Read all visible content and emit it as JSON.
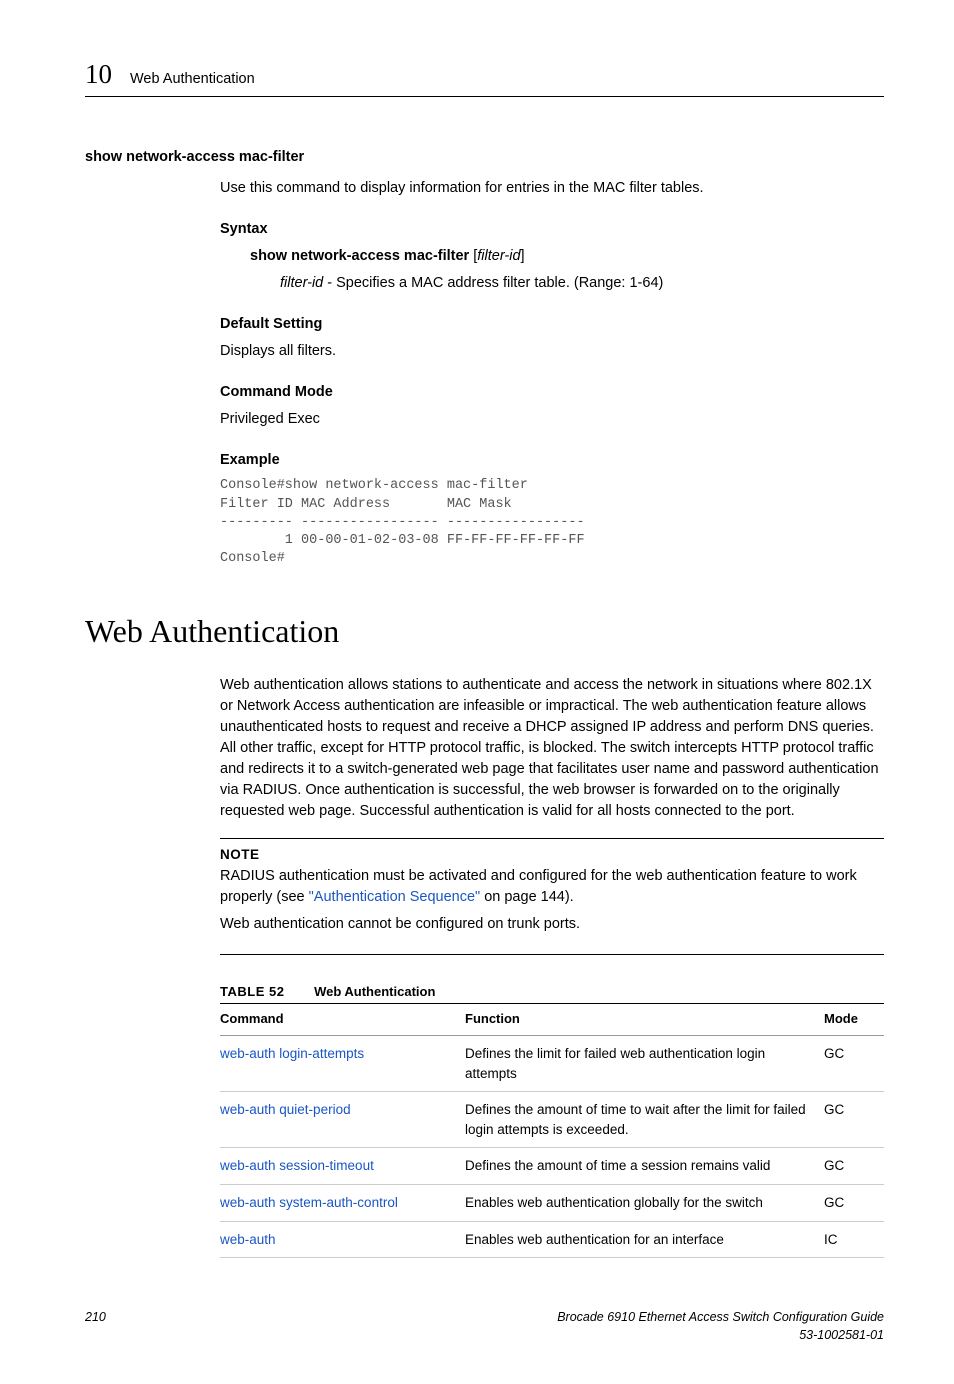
{
  "header": {
    "chapter_num": "10",
    "chapter_title": "Web Authentication"
  },
  "command": {
    "name": "show network-access mac-filter",
    "intro": "Use this command to display information for entries in the MAC filter tables.",
    "syntax_label": "Syntax",
    "syntax_cmd_bold": "show network-access mac-filter",
    "syntax_cmd_arg": "filter-id",
    "syntax_desc_prefix": "filter-id",
    "syntax_desc_rest": " - Specifies a MAC address filter table. (Range: 1-64)",
    "default_label": "Default Setting",
    "default_text": "Displays all filters.",
    "mode_label": "Command Mode",
    "mode_text": "Privileged Exec",
    "example_label": "Example",
    "example_code": "Console#show network-access mac-filter\nFilter ID MAC Address       MAC Mask\n--------- ----------------- -----------------\n        1 00-00-01-02-03-08 FF-FF-FF-FF-FF-FF\nConsole#"
  },
  "section": {
    "title": "Web Authentication",
    "body": "Web authentication allows stations to authenticate and access the network in situations where 802.1X or Network Access authentication are infeasible or impractical. The web authentication feature allows unauthenticated hosts to request and receive a DHCP assigned IP address and perform DNS queries. All other traffic, except for HTTP protocol traffic, is blocked. The switch intercepts HTTP protocol traffic and redirects it to a switch-generated web page that facilitates user name and password authentication via RADIUS. Once authentication is successful, the web browser is forwarded on to the originally requested web page. Successful authentication is valid for all hosts connected to the port.",
    "note_label": "NOTE",
    "note_line1a": "RADIUS authentication must be activated and configured for the web authentication feature to work properly (see ",
    "note_link": "\"Authentication Sequence\"",
    "note_line1b": " on page 144).",
    "note_line2": "Web authentication cannot be configured on trunk ports."
  },
  "table": {
    "label": "TABLE 52",
    "caption": "Web Authentication",
    "headers": {
      "c1": "Command",
      "c2": "Function",
      "c3": "Mode"
    },
    "rows": [
      {
        "cmd": "web-auth login-attempts",
        "func": "Defines the limit for failed web authentication login attempts",
        "mode": "GC"
      },
      {
        "cmd": "web-auth quiet-period",
        "func": "Defines the amount of time to wait after the limit for failed login attempts is exceeded.",
        "mode": "GC"
      },
      {
        "cmd": "web-auth session-timeout",
        "func": "Defines the amount of time a session remains valid",
        "mode": "GC"
      },
      {
        "cmd": "web-auth system-auth-control",
        "func": "Enables web authentication globally for the switch",
        "mode": "GC"
      },
      {
        "cmd": "web-auth",
        "func": "Enables web authentication for an interface",
        "mode": "IC"
      }
    ]
  },
  "footer": {
    "page": "210",
    "doc": "Brocade 6910 Ethernet Access Switch Configuration Guide",
    "partnum": "53-1002581-01"
  }
}
